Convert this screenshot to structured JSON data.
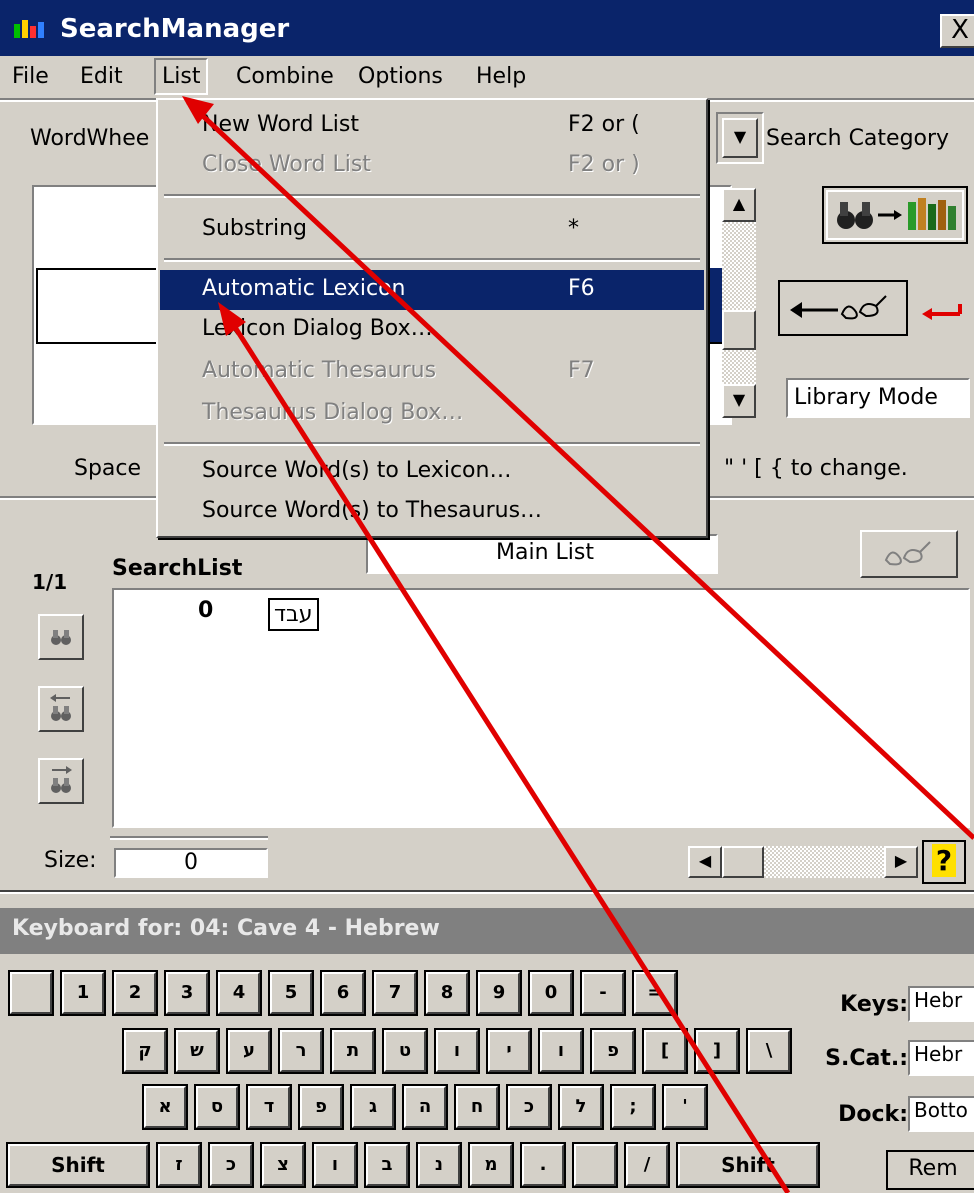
{
  "window": {
    "title": "SearchManager",
    "close_label": "X",
    "icon": "app-icon"
  },
  "menubar": {
    "items": [
      "File",
      "Edit",
      "List",
      "Combine",
      "Options",
      "Help"
    ],
    "active": "List"
  },
  "list_menu": {
    "items": [
      {
        "label": "New Word List",
        "shortcut": "F2 or ("
      },
      {
        "label": "Close Word List",
        "shortcut": "F2 or )"
      },
      {
        "label": "Substring",
        "shortcut": "*"
      },
      {
        "label": "Automatic Lexicon",
        "shortcut": "F6"
      },
      {
        "label": "Lexicon Dialog Box…",
        "shortcut": ""
      },
      {
        "label": "Automatic Thesaurus",
        "shortcut": "F7"
      },
      {
        "label": "Thesaurus Dialog Box…",
        "shortcut": ""
      },
      {
        "label": "Source Word(s) to Lexicon…",
        "shortcut": ""
      },
      {
        "label": "Source Word(s) to Thesaurus…",
        "shortcut": ""
      }
    ]
  },
  "top_panel": {
    "wordwheel_label": "WordWhee",
    "search_category_label": "Search Category",
    "library_mode": "Library Mode",
    "hint_left": "Space",
    "hint_right": "\" ' [ {  to change."
  },
  "searchlist": {
    "counter": "1/1",
    "label": "SearchList",
    "list_name": "Main List",
    "entry_count": "0",
    "entry_word": "עבד",
    "size_label": "Size:",
    "size_value": "0",
    "help_label": "?"
  },
  "keyboard": {
    "title": "Keyboard for: 04: Cave 4 - Hebrew",
    "row1": [
      "",
      "1",
      "2",
      "3",
      "4",
      "5",
      "6",
      "7",
      "8",
      "9",
      "0",
      "-",
      "="
    ],
    "row2": [
      "ק",
      "ש",
      "ע",
      "ר",
      "ת",
      "ט",
      "ו",
      "י",
      "ו",
      "פ",
      "[",
      "]",
      "\\"
    ],
    "row3": [
      "א",
      "ס",
      "ד",
      "פ",
      "ג",
      "ה",
      "ח",
      "כ",
      "ל",
      ";",
      "'"
    ],
    "row4": [
      "Shift",
      "ז",
      "כ",
      "צ",
      "ו",
      "ב",
      "נ",
      "מ",
      ".",
      "",
      "/",
      "Shift"
    ],
    "keys_label": "Keys:",
    "keys_value": "Hebr",
    "scat_label": "S.Cat.:",
    "scat_value": "Hebr",
    "dock_label": "Dock:",
    "dock_value": "Botto",
    "remove_label": "Rem"
  },
  "colors": {
    "accent": "#0a246a",
    "annotation": "#e00000",
    "face": "#d4d0c8"
  }
}
